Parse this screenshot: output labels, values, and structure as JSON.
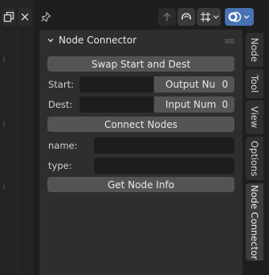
{
  "panel": {
    "title": "Node Connector",
    "swap_button": "Swap Start and Dest",
    "start_label": "Start:",
    "start_socket_label": "Output Nu",
    "start_socket_value": "0",
    "dest_label": "Dest:",
    "dest_socket_label": "Input Num",
    "dest_socket_value": "0",
    "connect_button": "Connect Nodes",
    "name_label": "name:",
    "type_label": "type:",
    "info_button": "Get Node Info"
  },
  "tabs": [
    "Node",
    "Tool",
    "View",
    "Options",
    "Node Connector"
  ],
  "active_tab": "Node Connector",
  "colors": {
    "accent_blue": "#4772b3",
    "panel_bg": "#2e2e2e",
    "button_bg": "#545454",
    "field_bg": "#1d1d1d"
  }
}
